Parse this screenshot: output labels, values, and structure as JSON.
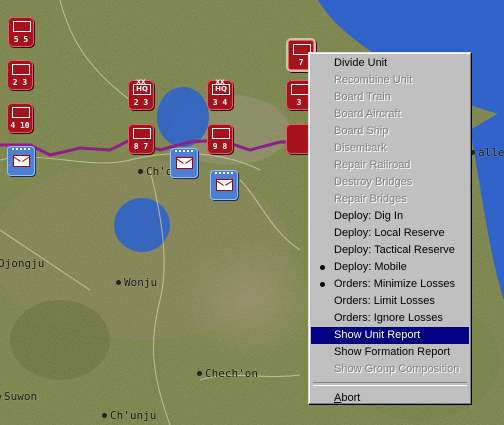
{
  "map": {
    "towns": [
      {
        "id": "chonan",
        "label": "Ch'on"
      },
      {
        "id": "ojongju",
        "label": "Ojongju"
      },
      {
        "id": "wonju",
        "label": "Wonju"
      },
      {
        "id": "chechon",
        "label": "Chech'on"
      },
      {
        "id": "suwon",
        "label": "Suwon"
      },
      {
        "id": "chunju",
        "label": "Ch'unju"
      },
      {
        "id": "alle",
        "label": "alle"
      }
    ],
    "units": [
      {
        "id": "u1",
        "ech": "",
        "mid": "",
        "size": "5  5"
      },
      {
        "id": "u2",
        "ech": "",
        "mid": "",
        "size": "2  3"
      },
      {
        "id": "u3",
        "ech": "",
        "mid": "",
        "size": "4 10"
      },
      {
        "id": "u4",
        "ech": "XX",
        "mid": "HQ",
        "size": "2  3"
      },
      {
        "id": "u5",
        "ech": "XX",
        "mid": "HQ",
        "size": "3  4"
      },
      {
        "id": "u6",
        "ech": "",
        "mid": "",
        "size": "8  7"
      },
      {
        "id": "u7",
        "ech": "",
        "mid": "",
        "size": "9  8"
      },
      {
        "id": "u8",
        "ech": "",
        "mid": "",
        "size": "7"
      },
      {
        "id": "u9",
        "ech": "",
        "mid": "",
        "size": "3"
      }
    ],
    "colors": {
      "friendly": "#a5121b",
      "enemy": "#4b7fd4",
      "front_line": "#8e1f8a",
      "water": "#2f63c9"
    }
  },
  "menu": {
    "items": [
      {
        "label": "Divide Unit",
        "enabled": true
      },
      {
        "label": "Recombine Unit",
        "enabled": false
      },
      {
        "label": "Board Train",
        "enabled": false
      },
      {
        "label": "Board Aircraft",
        "enabled": false
      },
      {
        "label": "Board Ship",
        "enabled": false
      },
      {
        "label": "Disembark",
        "enabled": false
      },
      {
        "label": "Repair Railroad",
        "enabled": false
      },
      {
        "label": "Destroy Bridges",
        "enabled": false
      },
      {
        "label": "Repair Bridges",
        "enabled": false
      },
      {
        "label": "Deploy: Dig In",
        "enabled": true
      },
      {
        "label": "Deploy: Local Reserve",
        "enabled": true
      },
      {
        "label": "Deploy: Tactical Reserve",
        "enabled": true
      },
      {
        "label": "Deploy: Mobile",
        "enabled": true,
        "checked": true
      },
      {
        "label": "Orders: Minimize Losses",
        "enabled": true,
        "checked": true
      },
      {
        "label": "Orders: Limit Losses",
        "enabled": true
      },
      {
        "label": "Orders: Ignore Losses",
        "enabled": true
      },
      {
        "label": "Show Unit Report",
        "enabled": true,
        "highlighted": true
      },
      {
        "label": "Show Formation Report",
        "enabled": true
      },
      {
        "label": "Show Group Composition",
        "enabled": false
      }
    ],
    "abort": {
      "label": "Abort",
      "accel": "A",
      "rest": "bort"
    }
  }
}
